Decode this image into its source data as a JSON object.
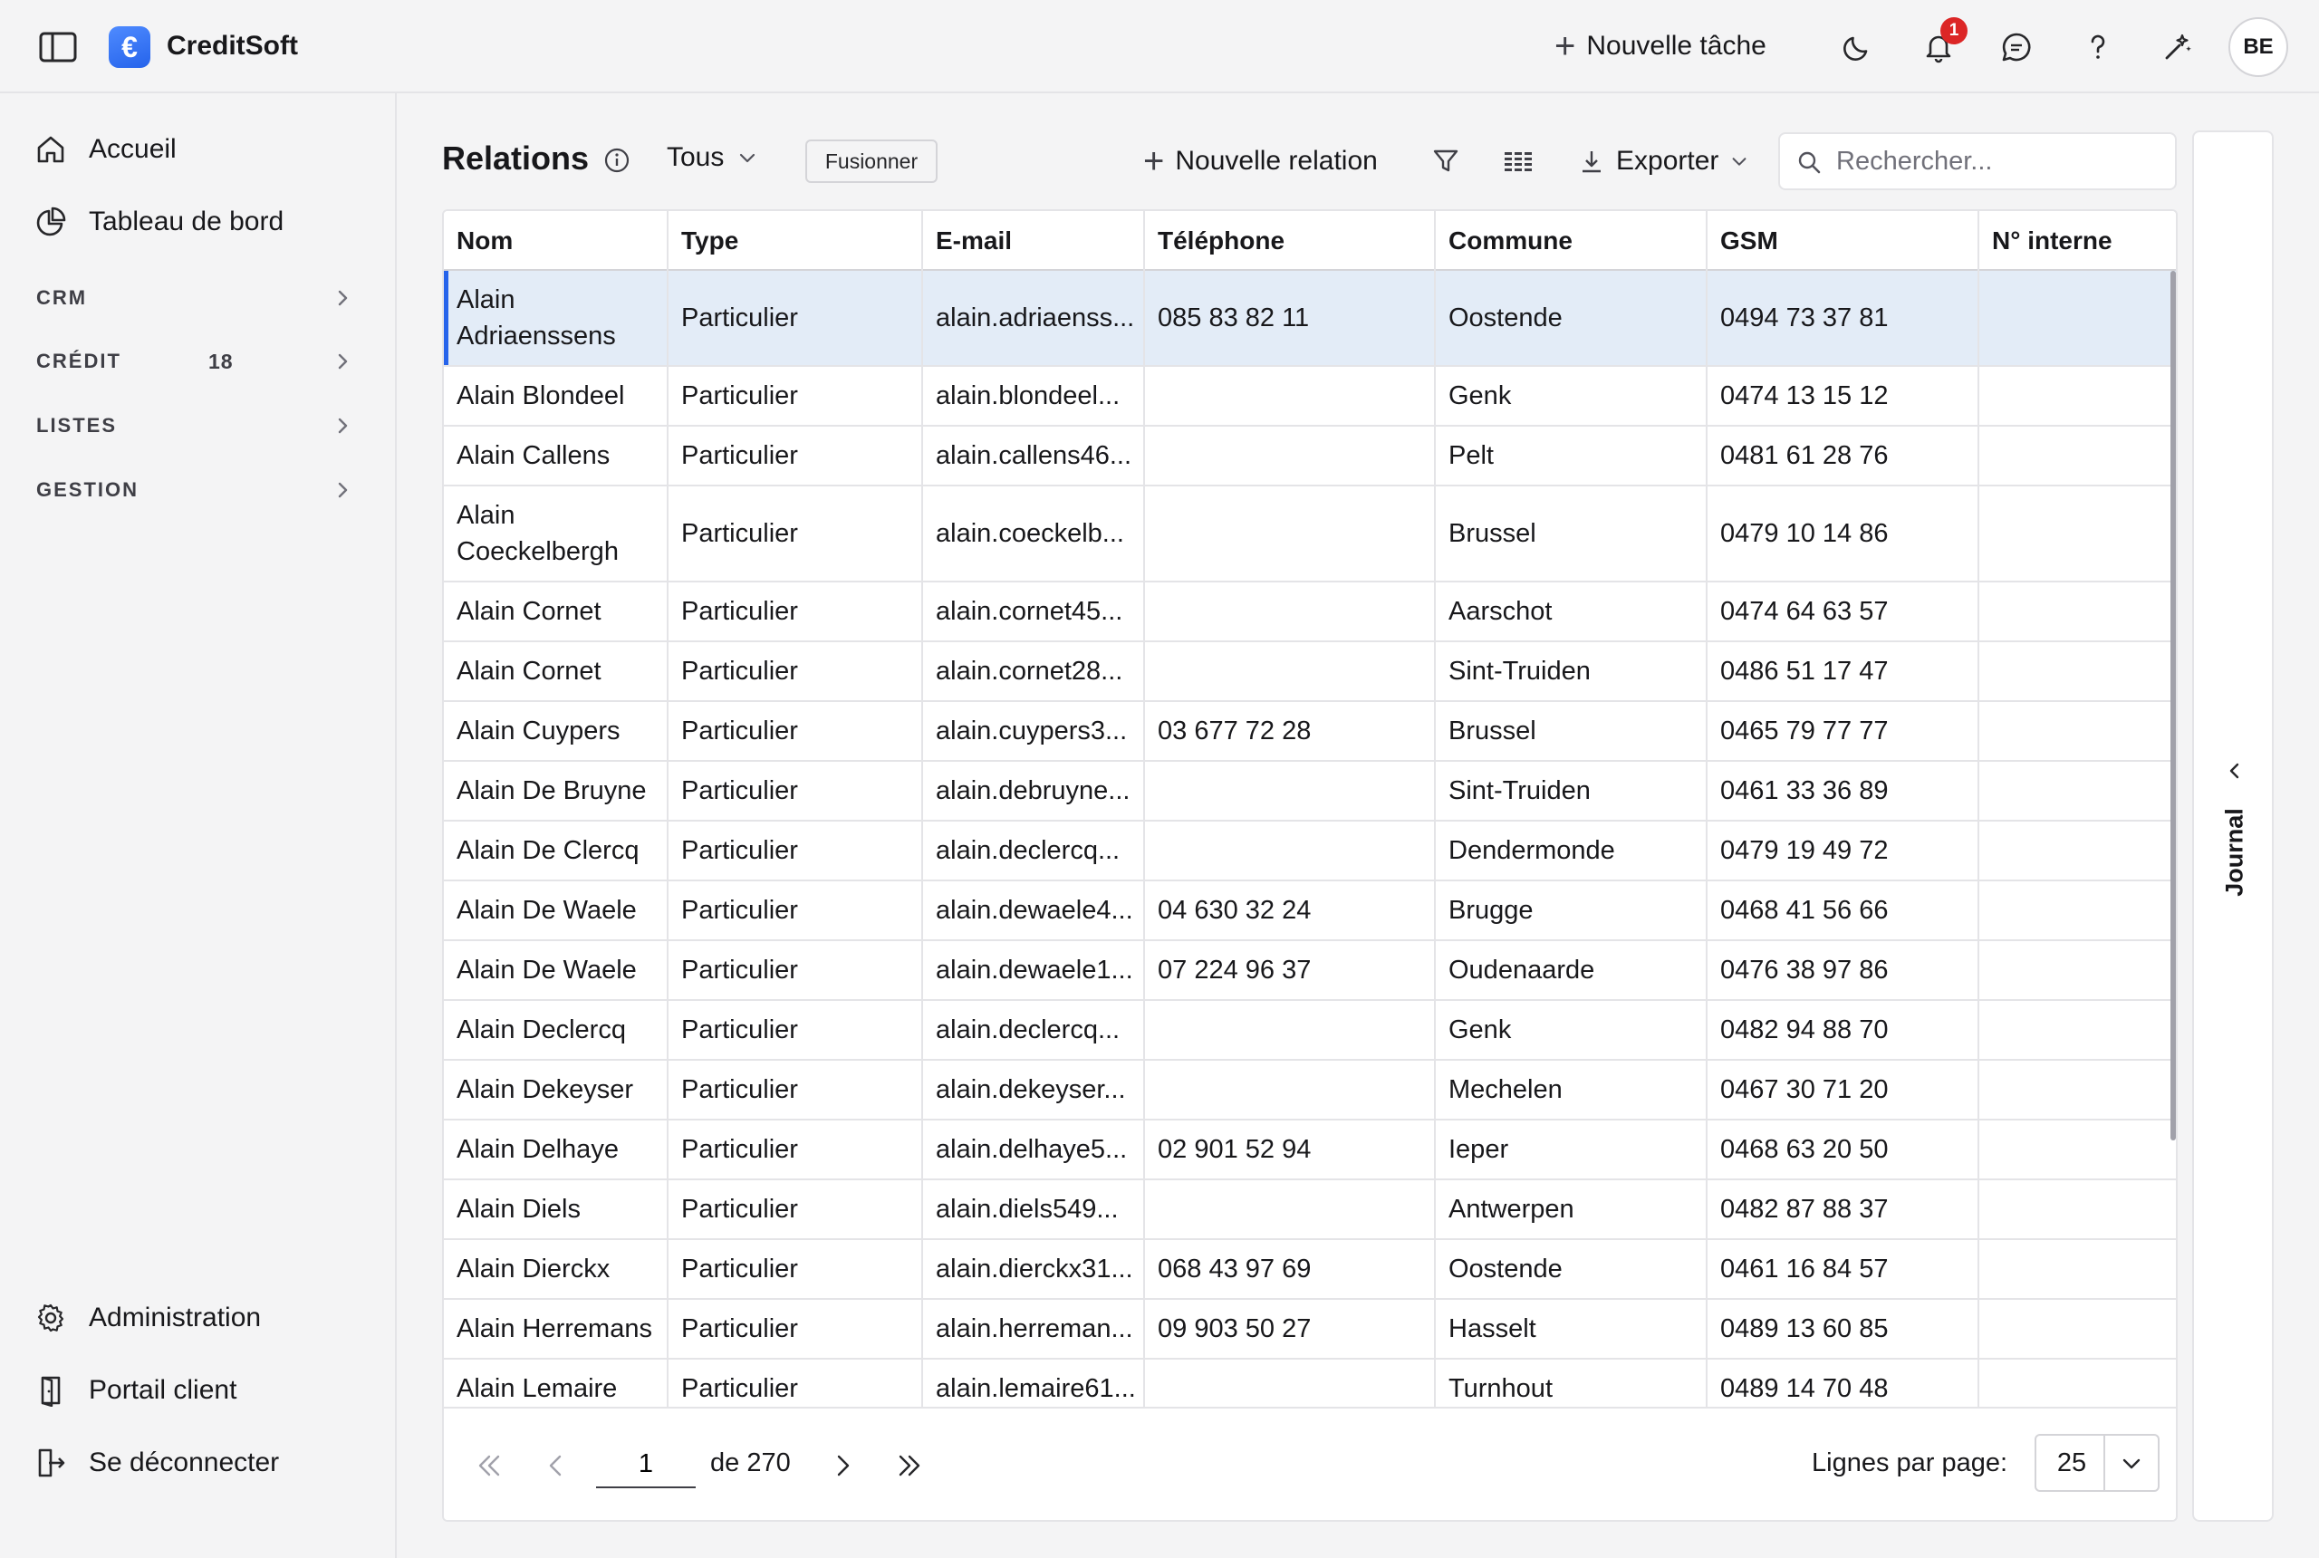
{
  "header": {
    "brand_symbol": "€",
    "brand_name": "CreditSoft",
    "new_task_label": "Nouvelle tâche",
    "notification_count": "1",
    "avatar_initials": "BE",
    "brand_color": "#2563eb",
    "badge_color": "#dc2626"
  },
  "sidebar": {
    "top_items": [
      {
        "label": "Accueil",
        "icon": "home-icon"
      },
      {
        "label": "Tableau de bord",
        "icon": "pie-chart-icon"
      }
    ],
    "sections": [
      {
        "label": "CRM",
        "count": ""
      },
      {
        "label": "CRÉDIT",
        "count": "18"
      },
      {
        "label": "LISTES",
        "count": ""
      },
      {
        "label": "GESTION",
        "count": ""
      }
    ],
    "bottom_items": [
      {
        "label": "Administration",
        "icon": "gear-icon"
      },
      {
        "label": "Portail client",
        "icon": "door-icon"
      },
      {
        "label": "Se déconnecter",
        "icon": "logout-icon"
      }
    ]
  },
  "toolbar": {
    "title": "Relations",
    "filter_value": "Tous",
    "merge_label": "Fusionner",
    "new_relation_label": "Nouvelle relation",
    "export_label": "Exporter",
    "search_placeholder": "Rechercher..."
  },
  "table": {
    "columns": [
      "Nom",
      "Type",
      "E-mail",
      "Téléphone",
      "Commune",
      "GSM",
      "N° interne"
    ],
    "rows": [
      {
        "nom": "Alain Adriaenssens",
        "type": "Particulier",
        "email": "alain.adriaenss...",
        "tel": "085 83 82 11",
        "commune": "Oostende",
        "gsm": "0494 73 37 81",
        "interne": "",
        "selected": true
      },
      {
        "nom": "Alain Blondeel",
        "type": "Particulier",
        "email": "alain.blondeel...",
        "tel": "",
        "commune": "Genk",
        "gsm": "0474 13 15 12",
        "interne": ""
      },
      {
        "nom": "Alain Callens",
        "type": "Particulier",
        "email": "alain.callens46...",
        "tel": "",
        "commune": "Pelt",
        "gsm": "0481 61 28 76",
        "interne": ""
      },
      {
        "nom": "Alain Coeckelbergh",
        "type": "Particulier",
        "email": "alain.coeckelb...",
        "tel": "",
        "commune": "Brussel",
        "gsm": "0479 10 14 86",
        "interne": ""
      },
      {
        "nom": "Alain Cornet",
        "type": "Particulier",
        "email": "alain.cornet45...",
        "tel": "",
        "commune": "Aarschot",
        "gsm": "0474 64 63 57",
        "interne": ""
      },
      {
        "nom": "Alain Cornet",
        "type": "Particulier",
        "email": "alain.cornet28...",
        "tel": "",
        "commune": "Sint-Truiden",
        "gsm": "0486 51 17 47",
        "interne": ""
      },
      {
        "nom": "Alain Cuypers",
        "type": "Particulier",
        "email": "alain.cuypers3...",
        "tel": "03 677 72 28",
        "commune": "Brussel",
        "gsm": "0465 79 77 77",
        "interne": ""
      },
      {
        "nom": "Alain De Bruyne",
        "type": "Particulier",
        "email": "alain.debruyne...",
        "tel": "",
        "commune": "Sint-Truiden",
        "gsm": "0461 33 36 89",
        "interne": ""
      },
      {
        "nom": "Alain De Clercq",
        "type": "Particulier",
        "email": "alain.declercq...",
        "tel": "",
        "commune": "Dendermonde",
        "gsm": "0479 19 49 72",
        "interne": ""
      },
      {
        "nom": "Alain De Waele",
        "type": "Particulier",
        "email": "alain.dewaele4...",
        "tel": "04 630 32 24",
        "commune": "Brugge",
        "gsm": "0468 41 56 66",
        "interne": ""
      },
      {
        "nom": "Alain De Waele",
        "type": "Particulier",
        "email": "alain.dewaele1...",
        "tel": "07 224 96 37",
        "commune": "Oudenaarde",
        "gsm": "0476 38 97 86",
        "interne": ""
      },
      {
        "nom": "Alain Declercq",
        "type": "Particulier",
        "email": "alain.declercq...",
        "tel": "",
        "commune": "Genk",
        "gsm": "0482 94 88 70",
        "interne": ""
      },
      {
        "nom": "Alain Dekeyser",
        "type": "Particulier",
        "email": "alain.dekeyser...",
        "tel": "",
        "commune": "Mechelen",
        "gsm": "0467 30 71 20",
        "interne": ""
      },
      {
        "nom": "Alain Delhaye",
        "type": "Particulier",
        "email": "alain.delhaye5...",
        "tel": "02 901 52 94",
        "commune": "Ieper",
        "gsm": "0468 63 20 50",
        "interne": ""
      },
      {
        "nom": "Alain Diels",
        "type": "Particulier",
        "email": "alain.diels549...",
        "tel": "",
        "commune": "Antwerpen",
        "gsm": "0482 87 88 37",
        "interne": ""
      },
      {
        "nom": "Alain Dierckx",
        "type": "Particulier",
        "email": "alain.dierckx31...",
        "tel": "068 43 97 69",
        "commune": "Oostende",
        "gsm": "0461 16 84 57",
        "interne": ""
      },
      {
        "nom": "Alain Herremans",
        "type": "Particulier",
        "email": "alain.herreman...",
        "tel": "09 903 50 27",
        "commune": "Hasselt",
        "gsm": "0489 13 60 85",
        "interne": ""
      },
      {
        "nom": "Alain Lemaire",
        "type": "Particulier",
        "email": "alain.lemaire61...",
        "tel": "",
        "commune": "Turnhout",
        "gsm": "0489 14 70 48",
        "interne": ""
      }
    ]
  },
  "pagination": {
    "current_page": "1",
    "total_label": "de 270",
    "rows_per_page_label": "Lignes par page:",
    "rows_per_page": "25"
  },
  "journal": {
    "label": "Journal"
  }
}
